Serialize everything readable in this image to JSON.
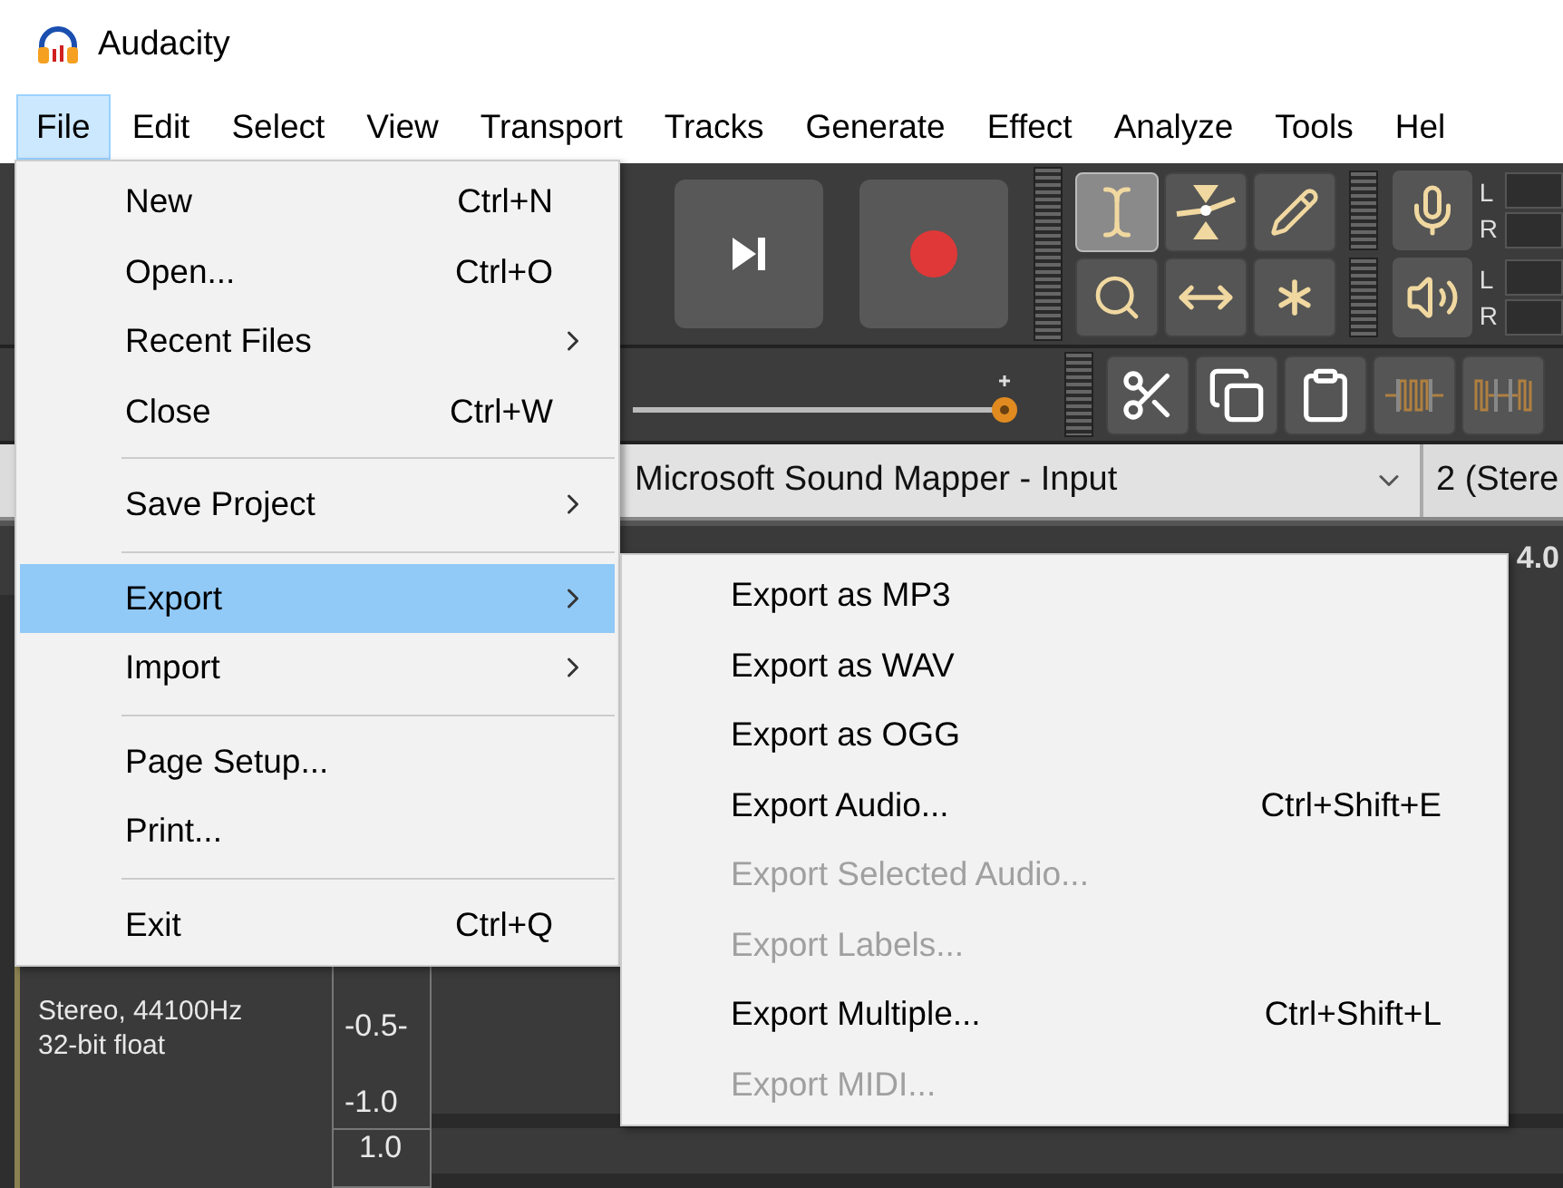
{
  "window": {
    "title": "Audacity"
  },
  "menu_bar": [
    {
      "label": "File",
      "selected": true
    },
    {
      "label": "Edit",
      "selected": false
    },
    {
      "label": "Select",
      "selected": false
    },
    {
      "label": "View",
      "selected": false
    },
    {
      "label": "Transport",
      "selected": false
    },
    {
      "label": "Tracks",
      "selected": false
    },
    {
      "label": "Generate",
      "selected": false
    },
    {
      "label": "Effect",
      "selected": false
    },
    {
      "label": "Analyze",
      "selected": false
    },
    {
      "label": "Tools",
      "selected": false
    },
    {
      "label": "Hel",
      "selected": false
    }
  ],
  "tools": [
    {
      "kind": "ibeam",
      "selected": true
    },
    {
      "kind": "envelope",
      "selected": false
    },
    {
      "kind": "draw",
      "selected": false
    },
    {
      "kind": "zoom",
      "selected": false
    },
    {
      "kind": "timeshift",
      "selected": false
    },
    {
      "kind": "multi",
      "selected": false
    }
  ],
  "meters": [
    {
      "kind": "record",
      "labels": [
        "L",
        "R"
      ]
    },
    {
      "kind": "play",
      "labels": [
        "L",
        "R"
      ]
    }
  ],
  "volume_slider": {
    "level": 1
  },
  "device_bar": {
    "input_device": "Microsoft Sound Mapper - Input",
    "channels": "2 (Stere"
  },
  "ruler": {
    "label": "4.0"
  },
  "track": {
    "info": [
      "Stereo, 44100Hz",
      "32-bit float"
    ],
    "scale": [
      "-0.5-",
      "-1.0"
    ]
  },
  "next_track": {
    "scale": "1.0"
  },
  "file_menu": [
    {
      "kind": "item",
      "label": "New",
      "shortcut": "Ctrl+N",
      "submenu": false,
      "selected": false
    },
    {
      "kind": "item",
      "label": "Open...",
      "shortcut": "Ctrl+O",
      "submenu": false,
      "selected": false
    },
    {
      "kind": "item",
      "label": "Recent Files",
      "submenu": true,
      "selected": false
    },
    {
      "kind": "item",
      "label": "Close",
      "shortcut": "Ctrl+W",
      "submenu": false,
      "selected": false
    },
    {
      "kind": "separator"
    },
    {
      "kind": "item",
      "label": "Save Project",
      "submenu": true,
      "selected": false
    },
    {
      "kind": "separator"
    },
    {
      "kind": "item",
      "label": "Export",
      "submenu": true,
      "selected": true
    },
    {
      "kind": "item",
      "label": "Import",
      "submenu": true,
      "selected": false
    },
    {
      "kind": "separator"
    },
    {
      "kind": "item",
      "label": "Page Setup...",
      "submenu": false,
      "selected": false
    },
    {
      "kind": "item",
      "label": "Print...",
      "submenu": false,
      "selected": false
    },
    {
      "kind": "separator"
    },
    {
      "kind": "item",
      "label": "Exit",
      "shortcut": "Ctrl+Q",
      "submenu": false,
      "selected": false
    }
  ],
  "export_menu": [
    {
      "label": "Export as MP3",
      "disabled": false
    },
    {
      "label": "Export as WAV",
      "disabled": false
    },
    {
      "label": "Export as OGG",
      "disabled": false
    },
    {
      "label": "Export Audio...",
      "shortcut": "Ctrl+Shift+E",
      "disabled": false
    },
    {
      "label": "Export Selected Audio...",
      "disabled": true
    },
    {
      "label": "Export Labels...",
      "disabled": true
    },
    {
      "label": "Export Multiple...",
      "shortcut": "Ctrl+Shift+L",
      "disabled": false
    },
    {
      "label": "Export MIDI...",
      "disabled": true
    }
  ]
}
